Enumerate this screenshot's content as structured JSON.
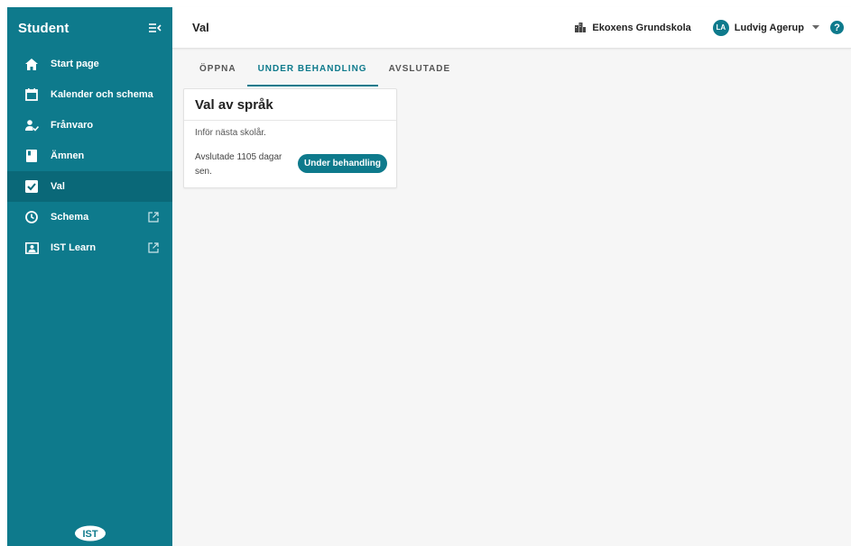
{
  "sidebar": {
    "title": "Student",
    "items": [
      {
        "label": "Start page",
        "icon": "home-icon",
        "external": false,
        "active": false
      },
      {
        "label": "Kalender och schema",
        "icon": "calendar-icon",
        "external": false,
        "active": false
      },
      {
        "label": "Frånvaro",
        "icon": "person-check-icon",
        "external": false,
        "active": false
      },
      {
        "label": "Ämnen",
        "icon": "book-icon",
        "external": false,
        "active": false
      },
      {
        "label": "Val",
        "icon": "checkbox-icon",
        "external": false,
        "active": true
      },
      {
        "label": "Schema",
        "icon": "clock-icon",
        "external": true,
        "active": false
      },
      {
        "label": "IST Learn",
        "icon": "presenter-icon",
        "external": true,
        "active": false
      }
    ],
    "logo_text": "IST"
  },
  "header": {
    "title": "Val",
    "school": "Ekoxens Grundskola",
    "user_initials": "LA",
    "user_name": "Ludvig Agerup",
    "help": "?"
  },
  "tabs": [
    {
      "label": "ÖPPNA",
      "active": false
    },
    {
      "label": "UNDER BEHANDLING",
      "active": true
    },
    {
      "label": "AVSLUTADE",
      "active": false
    }
  ],
  "card": {
    "title": "Val av språk",
    "description": "Inför nästa skolår.",
    "finished": "Avslutade 1105 dagar sen.",
    "status": "Under behandling"
  },
  "colors": {
    "accent": "#0e7a8c",
    "sidebar_active": "#0a6878",
    "background": "#f6f6f6"
  }
}
